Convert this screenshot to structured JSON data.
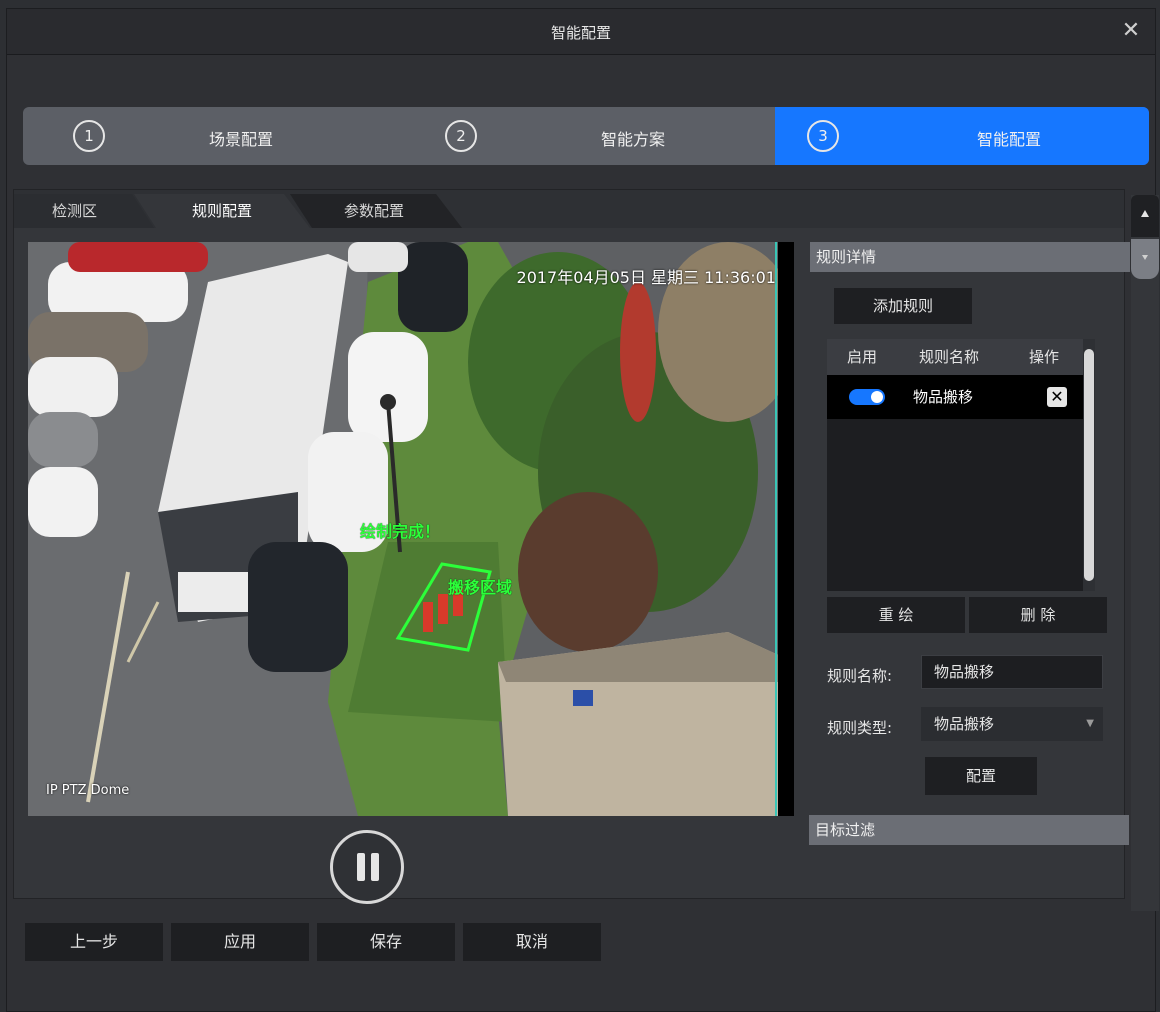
{
  "window": {
    "title": "智能配置",
    "close_symbol": "✕"
  },
  "steps": [
    {
      "number": "1",
      "label": "场景配置",
      "active": false
    },
    {
      "number": "2",
      "label": "智能方案",
      "active": false
    },
    {
      "number": "3",
      "label": "智能配置",
      "active": true
    }
  ],
  "tabs": [
    {
      "label": "检测区",
      "selected": false
    },
    {
      "label": "规则配置",
      "selected": true
    },
    {
      "label": "参数配置",
      "selected": false
    }
  ],
  "video": {
    "timestamp": "2017年04月05日 星期三 11:36:01",
    "camera_name": "IP PTZ Dome",
    "status_text": "绘制完成！",
    "region_label": "搬移区域"
  },
  "rule_details": {
    "header": "规则详情",
    "add_rule_label": "添加规则",
    "table": {
      "columns": [
        "启用",
        "规则名称",
        "操作"
      ],
      "rows": [
        {
          "enabled": true,
          "name": "物品搬移",
          "delete_symbol": "✕"
        }
      ]
    },
    "redraw_label": "重  绘",
    "delete_label": "删  除",
    "rule_name_label": "规则名称:",
    "rule_name_value": "物品搬移",
    "rule_type_label": "规则类型:",
    "rule_type_value": "物品搬移",
    "config_label": "配置"
  },
  "target_filter": {
    "header": "目标过滤"
  },
  "footer": {
    "prev_label": "上一步",
    "apply_label": "应用",
    "save_label": "保存",
    "cancel_label": "取消"
  },
  "colors": {
    "accent": "#1677ff",
    "overlay_green": "#2cff3a",
    "panel_bg": "#34363a"
  }
}
